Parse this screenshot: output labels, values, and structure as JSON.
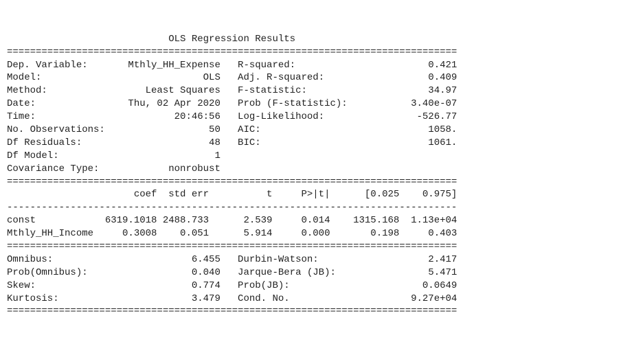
{
  "title": "OLS Regression Results",
  "rule_eq": "==============================================================================",
  "rule_dash": "------------------------------------------------------------------------------",
  "header": {
    "left_labels": [
      "Dep. Variable:",
      "Model:",
      "Method:",
      "Date:",
      "Time:",
      "No. Observations:",
      "Df Residuals:",
      "Df Model:",
      "Covariance Type:"
    ],
    "left_values": [
      "Mthly_HH_Expense",
      "OLS",
      "Least Squares",
      "Thu, 02 Apr 2020",
      "20:46:56",
      "50",
      "48",
      "1",
      "nonrobust"
    ],
    "right_labels": [
      "R-squared:",
      "Adj. R-squared:",
      "F-statistic:",
      "Prob (F-statistic):",
      "Log-Likelihood:",
      "AIC:",
      "BIC:"
    ],
    "right_values": [
      "0.421",
      "0.409",
      "34.97",
      "3.40e-07",
      "-526.77",
      "1058.",
      "1061."
    ]
  },
  "coef_table": {
    "cols": [
      "",
      "coef",
      "std err",
      "t",
      "P>|t|",
      "[0.025",
      "0.975]"
    ],
    "widths": [
      17,
      9,
      9,
      11,
      10,
      12,
      10
    ],
    "rows": [
      {
        "name": "const",
        "coef": "6319.1018",
        "stderr": "2488.733",
        "t": "2.539",
        "p": "0.014",
        "lo": "1315.168",
        "hi": "1.13e+04"
      },
      {
        "name": "Mthly_HH_Income",
        "coef": "0.3008",
        "stderr": "0.051",
        "t": "5.914",
        "p": "0.000",
        "lo": "0.198",
        "hi": "0.403"
      }
    ]
  },
  "diag": {
    "left_labels": [
      "Omnibus:",
      "Prob(Omnibus):",
      "Skew:",
      "Kurtosis:"
    ],
    "left_values": [
      "6.455",
      "0.040",
      "0.774",
      "3.479"
    ],
    "right_labels": [
      "Durbin-Watson:",
      "Jarque-Bera (JB):",
      "Prob(JB):",
      "Cond. No."
    ],
    "right_values": [
      "2.417",
      "5.471",
      "0.0649",
      "9.27e+04"
    ]
  },
  "layout": {
    "label_w": 20,
    "lval_w": 17,
    "gap": "   ",
    "rlabel_w": 22,
    "rval_w": 16
  },
  "chart_data": {
    "type": "table",
    "title": "OLS Regression Results",
    "dependent_variable": "Mthly_HH_Expense",
    "model": "OLS",
    "method": "Least Squares",
    "date": "Thu, 02 Apr 2020",
    "time": "20:46:56",
    "n_observations": 50,
    "df_residuals": 48,
    "df_model": 1,
    "covariance_type": "nonrobust",
    "r_squared": 0.421,
    "adj_r_squared": 0.409,
    "f_statistic": 34.97,
    "prob_f_statistic": 3.4e-07,
    "log_likelihood": -526.77,
    "aic": 1058.0,
    "bic": 1061.0,
    "coefficients": [
      {
        "term": "const",
        "coef": 6319.1018,
        "std_err": 2488.733,
        "t": 2.539,
        "p_value": 0.014,
        "ci_low": 1315.168,
        "ci_high": 11300.0
      },
      {
        "term": "Mthly_HH_Income",
        "coef": 0.3008,
        "std_err": 0.051,
        "t": 5.914,
        "p_value": 0.0,
        "ci_low": 0.198,
        "ci_high": 0.403
      }
    ],
    "diagnostics": {
      "omnibus": 6.455,
      "prob_omnibus": 0.04,
      "skew": 0.774,
      "kurtosis": 3.479,
      "durbin_watson": 2.417,
      "jarque_bera": 5.471,
      "prob_jb": 0.0649,
      "cond_no": 92700.0
    }
  }
}
